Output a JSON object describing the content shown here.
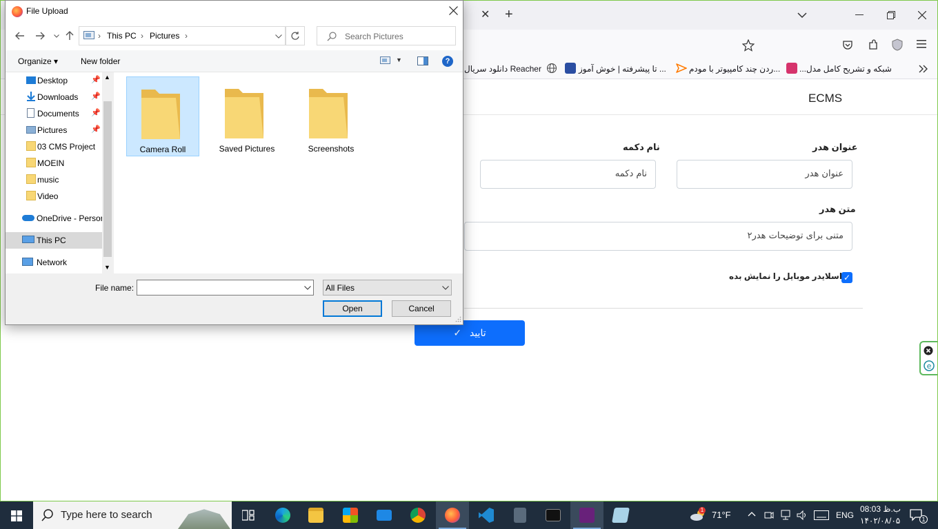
{
  "browser": {
    "title_tab_close": "✕",
    "new_tab": "+",
    "bookmarks": [
      {
        "label": "شبکه و تشریح کامل مدل...",
        "color": "#d6336c"
      },
      {
        "label": "...ردن چند کامپیوتر با مودم",
        "color": "#ff7a00"
      },
      {
        "label": "... تا پیشرفته | خوش آموز",
        "color": "#2b4ea2"
      },
      {
        "label": "Reacher دانلود سریال",
        "color": "#666666"
      }
    ]
  },
  "page": {
    "brand": "ECMS",
    "header_title_label": "عنوان هدر",
    "header_title_value": "عنوان هدر",
    "button_name_label": "نام دکمه",
    "button_name_value": "نام دکمه",
    "header_text_label": "متن هدر",
    "header_text_value": "متنی برای توضیحات هدر۲",
    "show_mobile_slider_label": "اسلایدر موبایل را نمایش بده",
    "show_mobile_slider_checked": true,
    "submit_label": "تایید",
    "submit_check": "✓",
    "accent_color": "#0d6efd"
  },
  "dialog": {
    "title": "File Upload",
    "breadcrumb": [
      "This PC",
      "Pictures"
    ],
    "search_placeholder": "Search Pictures",
    "organize_label": "Organize",
    "new_folder_label": "New folder",
    "help": "?",
    "nav_items": [
      {
        "label": "Desktop",
        "pinned": true,
        "icon": "desktop-icon"
      },
      {
        "label": "Downloads",
        "pinned": true,
        "icon": "download-icon"
      },
      {
        "label": "Documents",
        "pinned": true,
        "icon": "document-icon"
      },
      {
        "label": "Pictures",
        "pinned": true,
        "icon": "pictures-icon"
      },
      {
        "label": "03 CMS Project",
        "pinned": false,
        "icon": "folder-icon"
      },
      {
        "label": "MOEIN",
        "pinned": false,
        "icon": "folder-icon"
      },
      {
        "label": "music",
        "pinned": false,
        "icon": "folder-icon"
      },
      {
        "label": "Video",
        "pinned": false,
        "icon": "folder-icon"
      },
      {
        "label": "OneDrive - Persor",
        "pinned": false,
        "icon": "onedrive-icon"
      },
      {
        "label": "This PC",
        "pinned": false,
        "icon": "this-pc-icon",
        "selected": true
      },
      {
        "label": "Network",
        "pinned": false,
        "icon": "network-icon"
      }
    ],
    "folders": [
      {
        "label": "Camera Roll",
        "selected": true
      },
      {
        "label": "Saved Pictures",
        "selected": false
      },
      {
        "label": "Screenshots",
        "selected": false
      }
    ],
    "file_name_label": "File name:",
    "file_name_value": "",
    "file_type": "All Files",
    "open_label": "Open",
    "cancel_label": "Cancel"
  },
  "taskbar": {
    "search_placeholder": "Type here to search",
    "weather_temp": "71°F",
    "weather_badge": "1",
    "language": "ENG",
    "time": "08:03 ب.ظ",
    "date": "۱۴۰۲/۰۸/۰۵",
    "notification_count": "1"
  }
}
